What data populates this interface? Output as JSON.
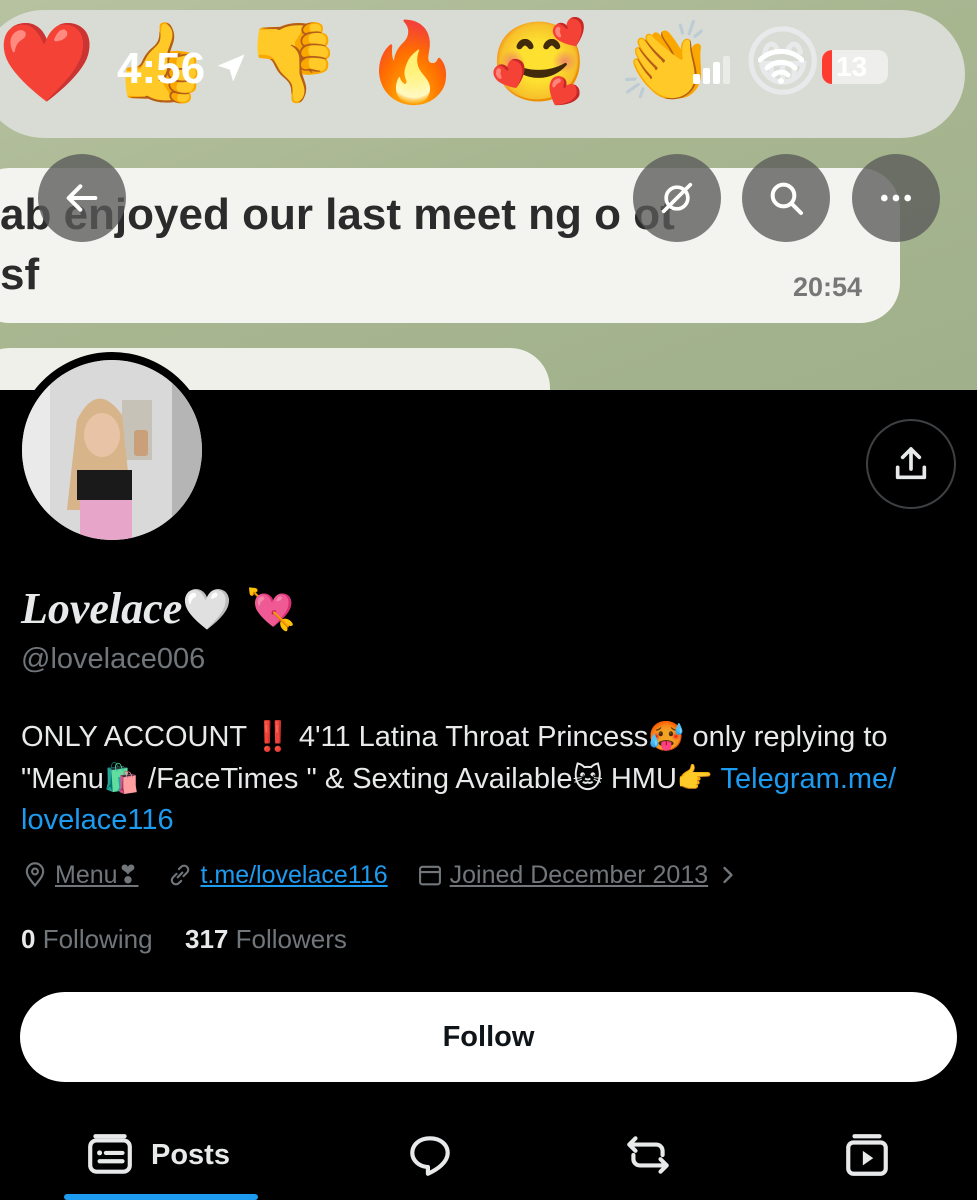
{
  "status_bar": {
    "time": "4:56",
    "battery": "13"
  },
  "banner": {
    "reactions": [
      "❤️",
      "👍",
      "👎",
      "🔥",
      "🥰",
      "👏",
      "😁"
    ],
    "message_line1": "ab  enjoyed our last meet ng  o  ot",
    "message_line2": "sf",
    "message_time": "20:54"
  },
  "header_actions": {
    "back_icon": "arrow-left-icon",
    "hide_icon": "eye-slash-icon",
    "search_icon": "search-icon",
    "more_icon": "more-icon"
  },
  "profile": {
    "display_name": "Lovelace",
    "display_name_emoji": "🤍 💘",
    "handle": "@lovelace006",
    "bio": {
      "p1": "ONLY ACCOUNT ",
      "e1": "‼️",
      "p2": " 4'11 Latina Throat Princess",
      "e2": "🥵",
      "p3": " only replying to \"Menu",
      "e3": "🛍️",
      "p4": " /FaceTimes \" & Sexting Available",
      "e4": "🐱",
      "p5": " HMU",
      "e5": "👉",
      "link": " Telegram.me/ lovelace116"
    },
    "location": "Menu❣",
    "website": "t.me/lovelace116",
    "joined": "Joined December 2013"
  },
  "counts": {
    "following_count": "0",
    "following_label": "Following",
    "followers_count": "317",
    "followers_label": "Followers"
  },
  "follow_button": "Follow",
  "tabs": {
    "posts_label": "Posts"
  },
  "colors": {
    "accent": "#1d9bf0",
    "background": "#000000",
    "muted": "#71767b"
  }
}
